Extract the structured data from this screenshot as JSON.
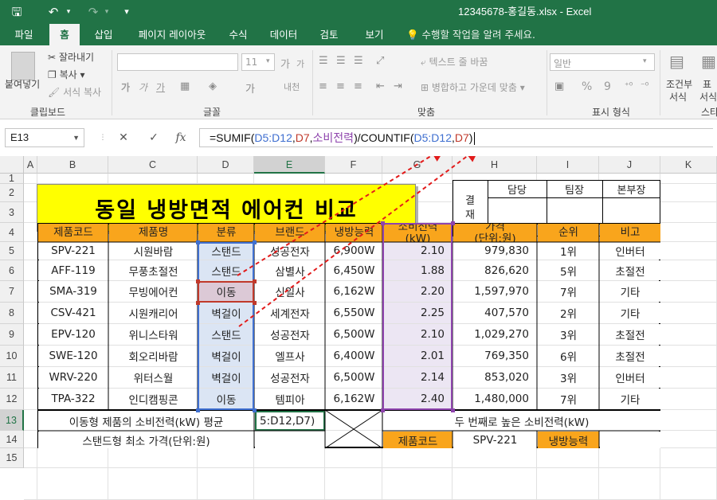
{
  "window": {
    "title": "12345678-홍길동.xlsx - Excel"
  },
  "quick_access": {
    "save": "🖫",
    "undo": "↶",
    "redo": "↷",
    "customize": "▾"
  },
  "tabs": [
    "파일",
    "홈",
    "삽입",
    "페이지 레이아웃",
    "수식",
    "데이터",
    "검토",
    "보기"
  ],
  "active_tab": "홈",
  "tell_me": "수행할 작업을 알려 주세요.",
  "ribbon": {
    "clipboard": {
      "paste": "붙여넣기",
      "cut": "잘라내기",
      "copy": "복사",
      "format_painter": "서식 복사",
      "label": "클립보드"
    },
    "font": {
      "size": "11",
      "label": "글꼴",
      "bold": "가",
      "italic": "가",
      "underline": "가",
      "grow": "가",
      "shrink": "가",
      "phonetic": "내천"
    },
    "alignment": {
      "wrap": "텍스트 줄 바꿈",
      "merge": "병합하고 가운데 맞춤",
      "label": "맞춤"
    },
    "number": {
      "format": "일반",
      "label": "표시 형식",
      "percent": "%",
      "comma": "9"
    },
    "styles": {
      "conditional": "조건부",
      "conditional2": "서식",
      "table": "표",
      "table2": "서식",
      "label": "스타"
    }
  },
  "formula_bar": {
    "name_box": "E13",
    "cancel": "✕",
    "enter": "✓",
    "fx": "fx",
    "parts": [
      {
        "t": "=SUMIF(",
        "c": "black"
      },
      {
        "t": "D5:D12",
        "c": "blue"
      },
      {
        "t": ",",
        "c": "black"
      },
      {
        "t": "D7",
        "c": "red"
      },
      {
        "t": ",",
        "c": "black"
      },
      {
        "t": "소비전력",
        "c": "purple"
      },
      {
        "t": ")/COUNTIF(",
        "c": "black"
      },
      {
        "t": "D5:D12",
        "c": "blue"
      },
      {
        "t": ",",
        "c": "black"
      },
      {
        "t": "D7",
        "c": "red"
      },
      {
        "t": ")",
        "c": "black"
      }
    ]
  },
  "columns": [
    "A",
    "B",
    "C",
    "D",
    "E",
    "F",
    "G",
    "H",
    "I",
    "J",
    "K"
  ],
  "rows": [
    "1",
    "2",
    "3",
    "4",
    "5",
    "6",
    "7",
    "8",
    "9",
    "10",
    "11",
    "12",
    "13",
    "14",
    "15"
  ],
  "banner": "동일 냉방면적 에어컨 비교",
  "approval": {
    "side": "결\n재",
    "headers": [
      "담당",
      "팀장",
      "본부장"
    ]
  },
  "table": {
    "headers": [
      "제품코드",
      "제품명",
      "분류",
      "브랜드",
      "냉방능력",
      "소비전력\n(kW)",
      "가격\n(단위:원)",
      "순위",
      "비고"
    ],
    "rows": [
      [
        "SPV-221",
        "시원바람",
        "스탠드",
        "성공전자",
        "6,900W",
        "2.10",
        "979,830",
        "1위",
        "인버터"
      ],
      [
        "AFF-119",
        "무풍초절전",
        "스탠드",
        "삼별사",
        "6,450W",
        "1.88",
        "826,620",
        "5위",
        "초절전"
      ],
      [
        "SMA-319",
        "무빙에어컨",
        "이동",
        "신일사",
        "6,162W",
        "2.20",
        "1,597,970",
        "7위",
        "기타"
      ],
      [
        "CSV-421",
        "시원캐리어",
        "벽걸이",
        "세계전자",
        "6,550W",
        "2.25",
        "407,570",
        "2위",
        "기타"
      ],
      [
        "EPV-120",
        "위니스타워",
        "스탠드",
        "성공전자",
        "6,500W",
        "2.10",
        "1,029,270",
        "3위",
        "초절전"
      ],
      [
        "SWE-120",
        "회오리바람",
        "벽걸이",
        "엘프사",
        "6,400W",
        "2.01",
        "769,350",
        "6위",
        "초절전"
      ],
      [
        "WRV-220",
        "위터스월",
        "벽걸이",
        "성공전자",
        "6,500W",
        "2.14",
        "853,020",
        "3위",
        "인버터"
      ],
      [
        "TPA-322",
        "인디캠핑콘",
        "이동",
        "템피아",
        "6,162W",
        "2.40",
        "1,480,000",
        "7위",
        "기타"
      ]
    ]
  },
  "summary": {
    "row13_label": "이동형 제품의 소비전력(kW) 평균",
    "row13_edit": "5:D12,D7)",
    "row13_right": "두 번째로 높은 소비전력(kW)",
    "row14_label": "스탠드형 최소 가격(단위:원)",
    "row14_code_hdr": "제품코드",
    "row14_code_val": "SPV-221",
    "row14_cap_hdr": "냉방능력"
  },
  "colors": {
    "excel_green": "#217346",
    "header_orange": "#f9a51c",
    "banner_yellow": "#ffff00",
    "ref_blue": "#3f6fd0",
    "ref_red": "#c0392b",
    "ref_purple": "#8e44ad"
  }
}
